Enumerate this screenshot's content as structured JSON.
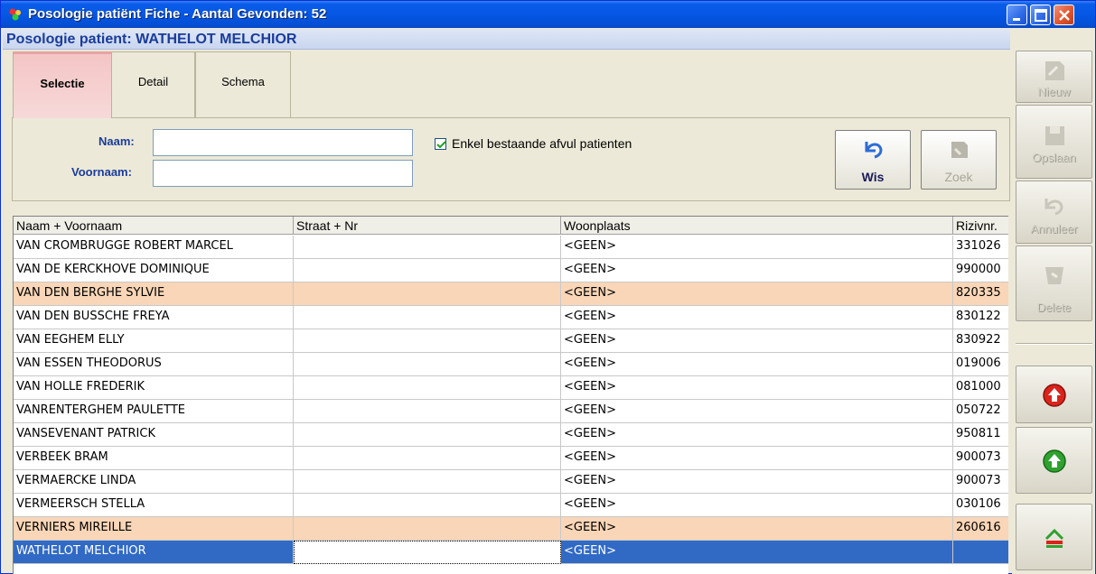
{
  "window": {
    "title": "Posologie patiënt Fiche - Aantal Gevonden: 52"
  },
  "header": {
    "patient_label": "Posologie patient: WATHELOT MELCHIOR"
  },
  "tabs": [
    {
      "label": "Selectie",
      "active": true
    },
    {
      "label": "Detail",
      "active": false
    },
    {
      "label": "Schema",
      "active": false
    }
  ],
  "form": {
    "naam_label": "Naam:",
    "naam_value": "",
    "voornaam_label": "Voornaam:",
    "voornaam_value": "",
    "checkbox_label": "Enkel bestaande afvul patienten",
    "checkbox_checked": true,
    "wis_label": "Wis",
    "zoek_label": "Zoek"
  },
  "grid": {
    "columns": [
      "Naam + Voornaam",
      "Straat + Nr",
      "Woonplaats",
      "Rizivnr."
    ],
    "rows": [
      {
        "name": "VAN CROMBRUGGE ROBERT MARCEL",
        "street": "",
        "city": "<GEEN>",
        "riziv": "331026",
        "style": "normal"
      },
      {
        "name": "VAN DE KERCKHOVE DOMINIQUE",
        "street": "",
        "city": "<GEEN>",
        "riziv": "990000",
        "style": "normal"
      },
      {
        "name": "VAN DEN BERGHE SYLVIE",
        "street": "",
        "city": "<GEEN>",
        "riziv": "820335",
        "style": "highlight"
      },
      {
        "name": "VAN DEN BUSSCHE FREYA",
        "street": "",
        "city": "<GEEN>",
        "riziv": "830122",
        "style": "normal"
      },
      {
        "name": "VAN EEGHEM ELLY",
        "street": "",
        "city": "<GEEN>",
        "riziv": "830922",
        "style": "normal"
      },
      {
        "name": "VAN ESSEN THEODORUS",
        "street": "",
        "city": "<GEEN>",
        "riziv": "019006",
        "style": "normal"
      },
      {
        "name": "VAN HOLLE FREDERIK",
        "street": "",
        "city": "<GEEN>",
        "riziv": "081000",
        "style": "normal"
      },
      {
        "name": "VANRENTERGHEM PAULETTE",
        "street": "",
        "city": "<GEEN>",
        "riziv": "050722",
        "style": "normal"
      },
      {
        "name": "VANSEVENANT PATRICK",
        "street": "",
        "city": "<GEEN>",
        "riziv": "950811",
        "style": "normal"
      },
      {
        "name": "VERBEEK BRAM",
        "street": "",
        "city": "<GEEN>",
        "riziv": "900073",
        "style": "normal"
      },
      {
        "name": "VERMAERCKE LINDA",
        "street": "",
        "city": "<GEEN>",
        "riziv": "900073",
        "style": "normal"
      },
      {
        "name": "VERMEERSCH STELLA",
        "street": "",
        "city": "<GEEN>",
        "riziv": "030106",
        "style": "normal"
      },
      {
        "name": "VERNIERS MIREILLE",
        "street": "",
        "city": "<GEEN>",
        "riziv": "260616",
        "style": "highlight"
      },
      {
        "name": "WATHELOT MELCHIOR",
        "street": "",
        "city": "<GEEN>",
        "riziv": "",
        "style": "selected"
      }
    ]
  },
  "toolbar": {
    "nieuw_label": "Nieuw",
    "opslaan_label": "Opslaan",
    "annuleer_label": "Annuleer",
    "delete_label": "Delete",
    "up_icon": "arrow-up-red-icon",
    "down_icon": "arrow-up-green-icon",
    "exit_icon": "exit-icon"
  },
  "colors": {
    "titlebar": "#0a5ce8",
    "header_text": "#1a3c9b",
    "row_highlight": "#f9d6b7",
    "row_selected": "#316ac5",
    "tab_active": "#f4c5c5"
  }
}
